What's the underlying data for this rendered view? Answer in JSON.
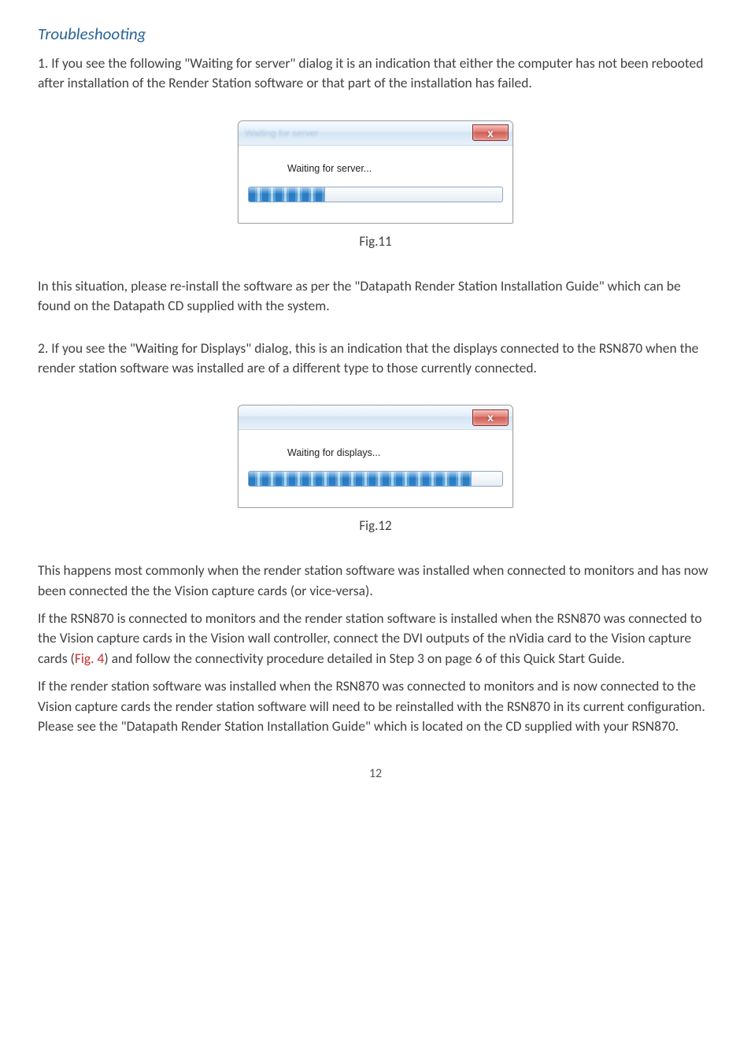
{
  "section_title": "Troubleshooting",
  "para_1": "1.  If you see the following \"Waiting for server\" dialog it is an indication that either the computer has not been rebooted after installation of the Render Station software or that part of the installation has failed.",
  "dialog1": {
    "title_blur": "Waiting for server",
    "message": "Waiting for server...",
    "progress_percent": 30,
    "close_char": "x"
  },
  "fig1_caption": "Fig.11",
  "para_2": "In this situation, please re-install the software as per the \"Datapath Render Station Installation Guide\" which can be found on the Datapath CD supplied with the system.",
  "para_3": "2.  If you see the \"Waiting for Displays\" dialog, this is an indication that the displays connected to the RSN870 when the render station software was installed are of a different type to those currently connected.",
  "dialog2": {
    "title_blur": "",
    "message": "Waiting for displays...",
    "progress_percent": 88,
    "close_char": "x"
  },
  "fig2_caption": "Fig.12",
  "para_4": "This happens most commonly when the render station software was installed when connected to monitors and has now been connected the the Vision capture cards (or vice-versa).",
  "para_5a": "If the RSN870 is connected to monitors and the render station software is installed when the RSN870 was connected to the Vision capture cards in the Vision wall controller, connect the DVI outputs of the nVidia card to the Vision capture cards (",
  "figref": "Fig. 4",
  "para_5b": ") and follow the connectivity procedure detailed in Step 3 on page 6 of this Quick Start Guide.",
  "para_6": "If the render station software was installed when the RSN870 was connected to monitors and is now connected to the Vision capture cards the render station software will need to be reinstalled with the RSN870 in its current configuration.   Please see the \"Datapath Render Station Installation Guide\" which is located on the CD supplied with your RSN870.",
  "page_number": "12"
}
